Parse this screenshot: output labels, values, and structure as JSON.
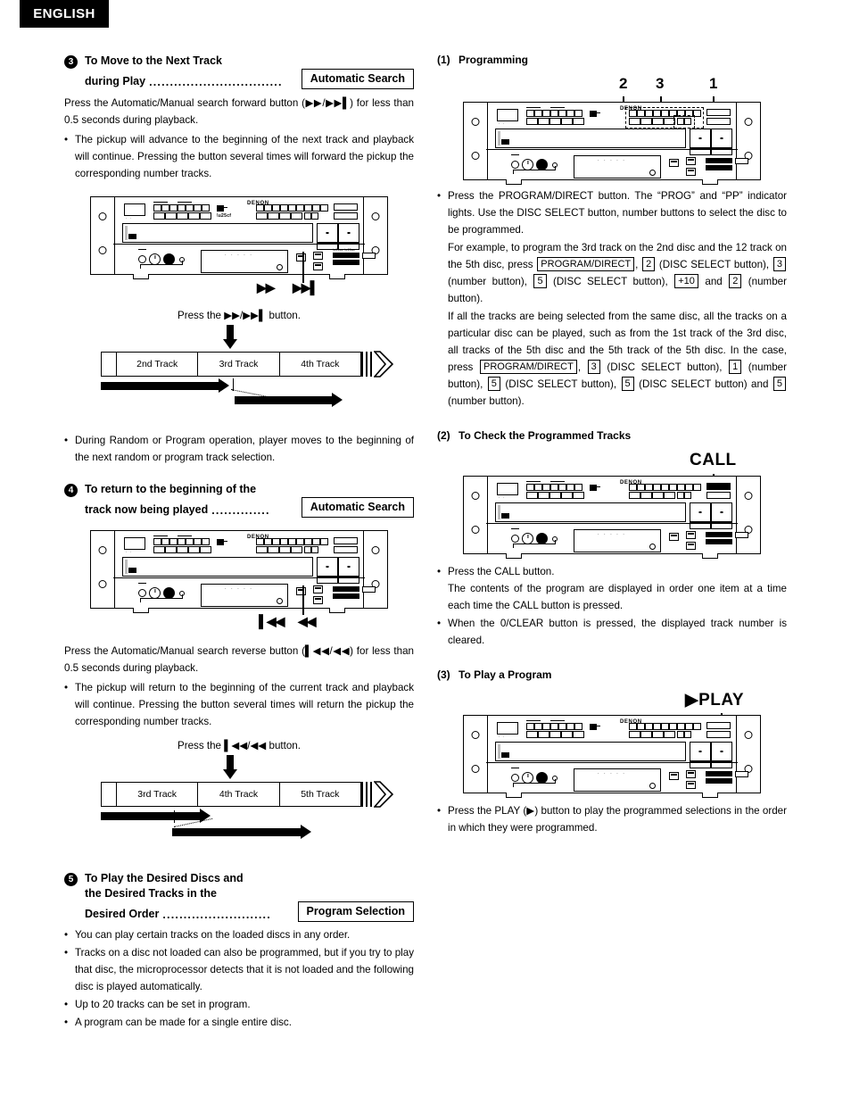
{
  "header": {
    "language": "ENGLISH"
  },
  "left": {
    "section3": {
      "number": "3",
      "title_line1": "To Move to the Next Track",
      "title_line2": "during Play",
      "dots": "................................",
      "tag": "Automatic Search",
      "para": "Press the Automatic/Manual search forward button (▶▶/▶▶▌) for less than 0.5 seconds during playback.",
      "bullets": [
        "The pickup will advance to the beginning of the next track and playback will continue. Pressing the button several times will forward the pickup the corresponding number tracks."
      ],
      "device_glyph_left": "▶▶",
      "device_glyph_right": "▶▶▌",
      "press_caption": "Press the ▶▶/▶▶▌ button.",
      "timeline": {
        "tracks": [
          "2nd Track",
          "3rd Track",
          "4th Track"
        ]
      },
      "after_bullets": [
        "During Random or Program operation, player moves to the beginning of the next random or program track selection."
      ]
    },
    "section4": {
      "number": "4",
      "title_line1": "To return to the beginning of the",
      "title_line2": "track now being played",
      "dots": "..............",
      "tag": "Automatic Search",
      "device_glyph_left": "▌◀◀",
      "device_glyph_right": "◀◀",
      "para": "Press the Automatic/Manual search reverse button (▌◀◀/◀◀) for less than 0.5 seconds during playback.",
      "bullets": [
        "The pickup will return to the beginning of the current track and playback will continue. Pressing the button several times will return the pickup the corresponding number tracks."
      ],
      "press_caption": "Press the ▌◀◀/◀◀ button.",
      "timeline": {
        "tracks": [
          "3rd Track",
          "4th Track",
          "5th Track"
        ]
      }
    },
    "section5": {
      "number": "5",
      "title_line1": "To Play the Desired Discs and",
      "title_line2": "the Desired Tracks in the",
      "title_line3": "Desired Order",
      "dots": "..........................",
      "tag": "Program Selection",
      "bullets": [
        "You can play certain tracks on the loaded discs in any order.",
        "Tracks on a disc not loaded can also be programmed, but if you try to play that disc, the microprocessor detects that it is not loaded and the following disc is played automatically.",
        "Up to 20 tracks can be set in program.",
        "A program can be made for a single entire disc."
      ]
    }
  },
  "right": {
    "part1": {
      "label": "(1)",
      "title": "Programming",
      "callouts": [
        "2",
        "3",
        "1"
      ],
      "bullet1_lines": [
        "Press the PROGRAM/DIRECT button. The “PROG” and “PP” indicator lights. Use the DISC SELECT button, number buttons to select the disc to be programmed."
      ],
      "para_example_a": "For example, to program the 3rd track on the 2nd disc and the 12 track on the 5th disc, press",
      "example_keys": [
        "PROGRAM/DIRECT",
        "2",
        "3",
        "5",
        "+10",
        "2"
      ],
      "para_example_b": "If all the tracks are being selected from the same disc, all the tracks on a particular disc can be played, such as from the 1st track of the 3rd disc, all tracks of the 5th disc and the 5th track of the 5th disc. In the case, press",
      "example2_keys": [
        "PROGRAM/DIRECT",
        "3",
        "1",
        "5",
        "5",
        "5"
      ],
      "ex_t1": ", ",
      "ex_t2": " (DISC SELECT button), ",
      "ex_t3": " (number button), ",
      "ex_t4": " (DISC SELECT button), ",
      "ex_t5": " and ",
      "ex_t6": " (number button).",
      "ex2_t2": " (DISC SELECT button), ",
      "ex2_t3": " (number button), ",
      "ex2_t4": " (DISC SELECT button), ",
      "ex2_t5": " (DISC SELECT button) and ",
      "ex2_t6": " (number button)."
    },
    "part2": {
      "label": "(2)",
      "title": "To Check the Programmed Tracks",
      "callout_label": "CALL",
      "bullets": [
        "Press the CALL button. The contents of the program are displayed in order one item at a time each time the CALL button is pressed.",
        "When the 0/CLEAR button is pressed, the displayed track number is cleared."
      ],
      "bullet1_line1": "Press the CALL button.",
      "bullet1_line2": "The contents of the program are displayed in order one item at a time each time the CALL button is pressed."
    },
    "part3": {
      "label": "(3)",
      "title": "To Play a Program",
      "callout_label": "▶PLAY",
      "bullets": [
        "Press the PLAY (▶) button to play the programmed selections in the order in which they were programmed."
      ]
    }
  },
  "colors": {
    "ink": "#000000",
    "paper": "#ffffff",
    "tray_shade": "#bdbdbd"
  }
}
